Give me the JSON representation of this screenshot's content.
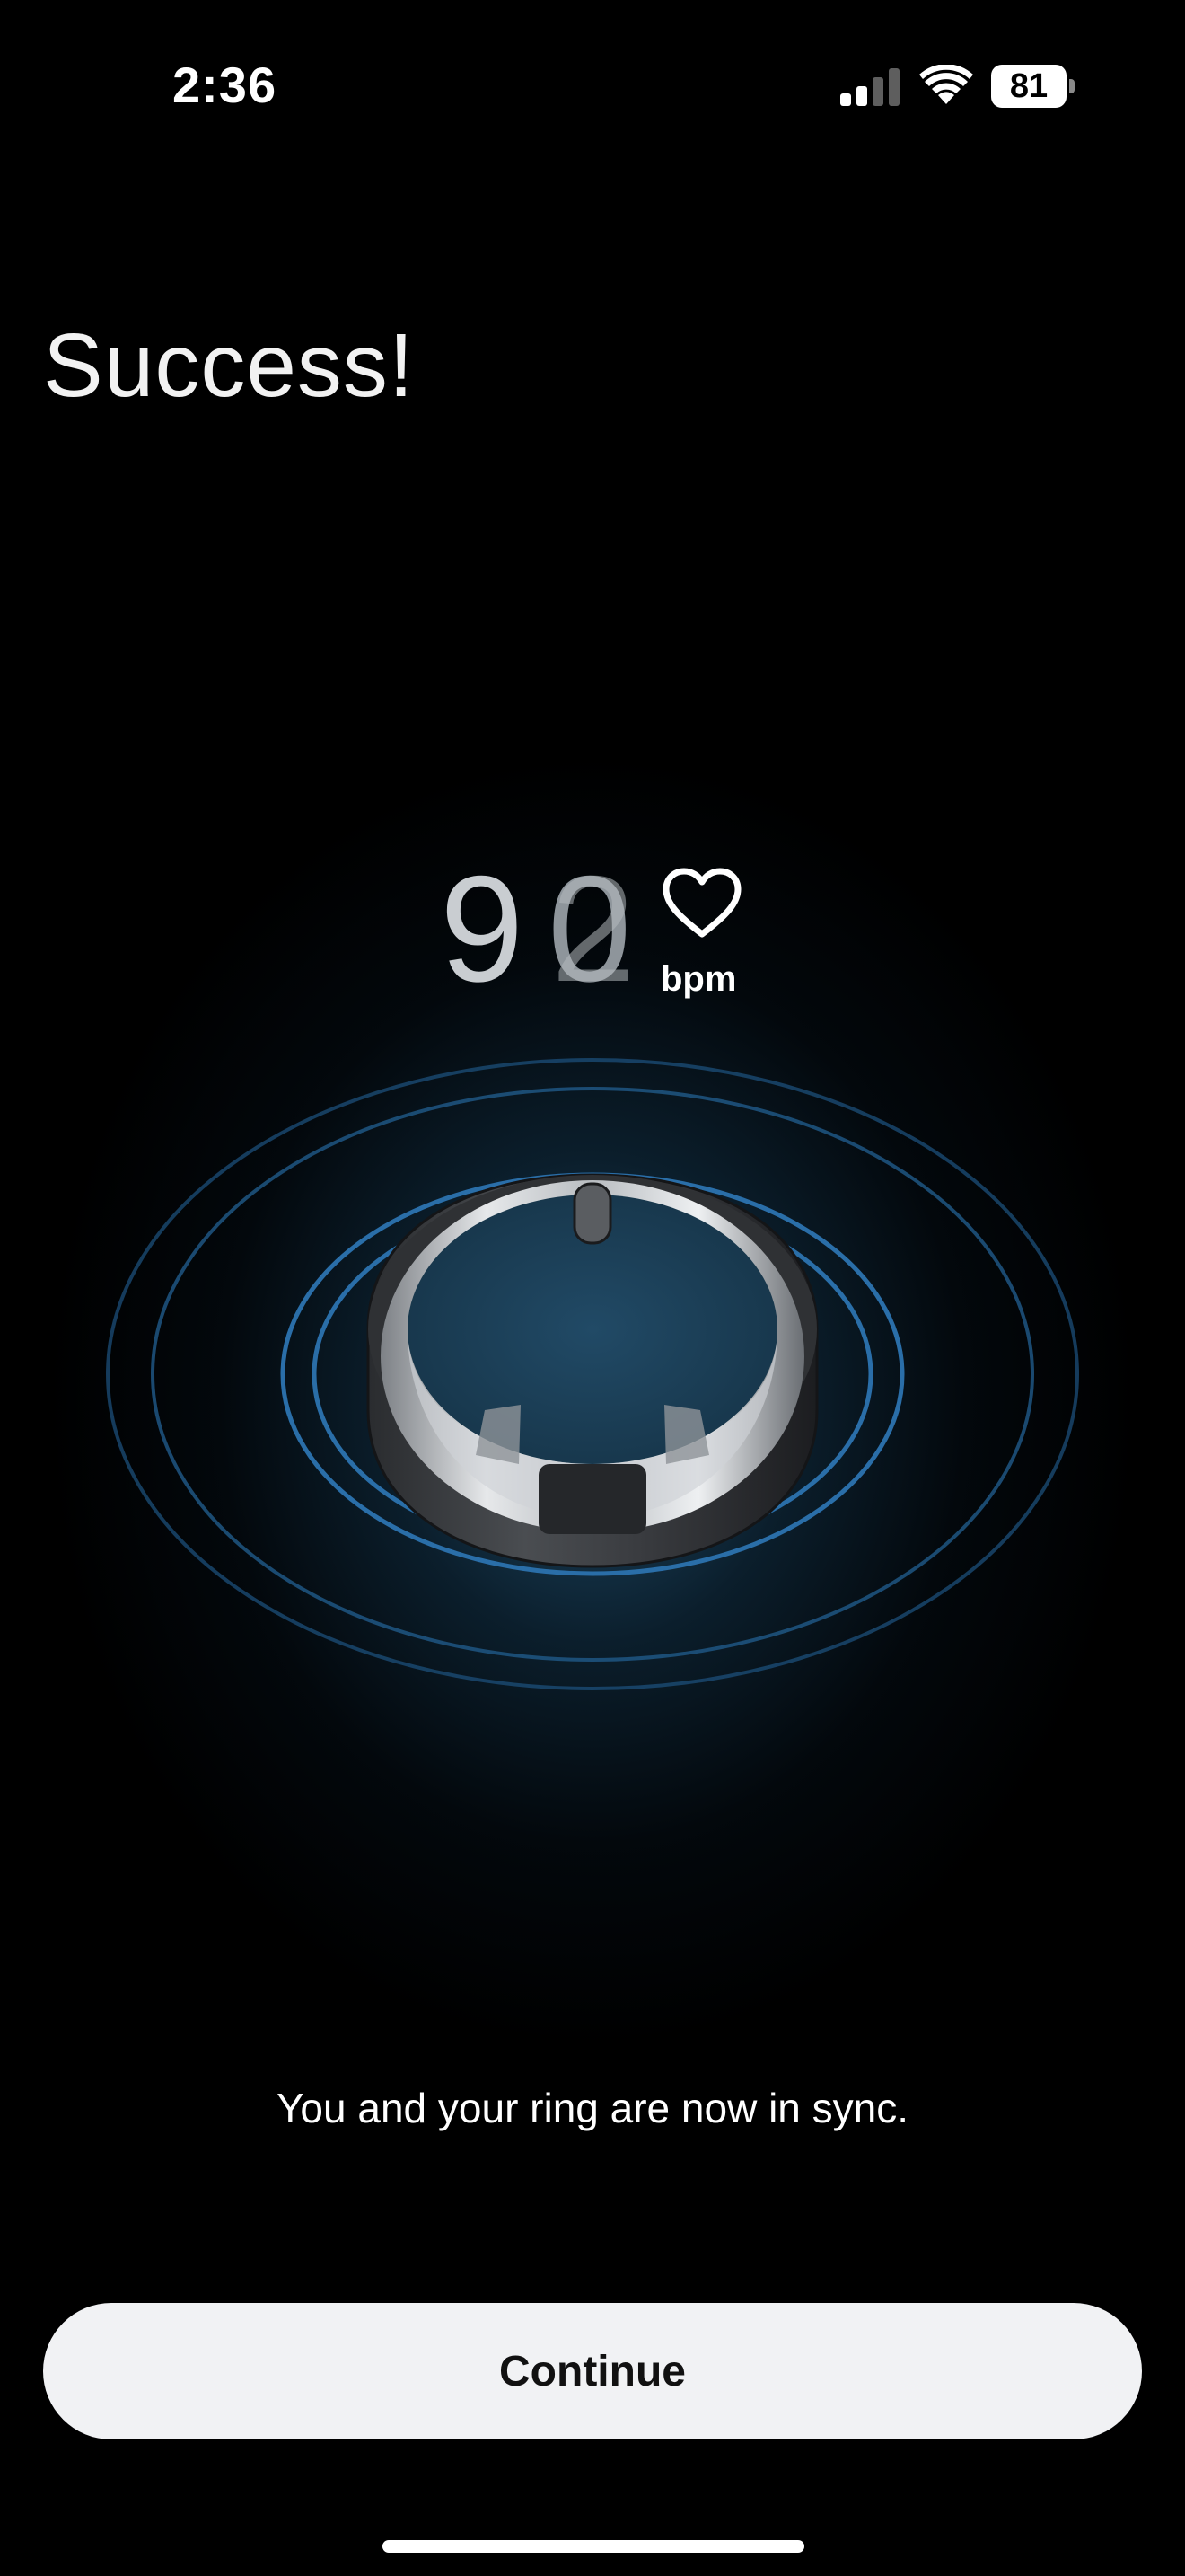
{
  "status_bar": {
    "time": "2:36",
    "battery_percent": "81",
    "signal_icon": "cellular-signal-icon",
    "wifi_icon": "wifi-icon"
  },
  "page": {
    "title": "Success!",
    "subtitle": "You and your ring are now in sync."
  },
  "heart_rate": {
    "digit_1": "9",
    "digit_2": "0",
    "digit_3": "2",
    "unit": "bpm",
    "icon": "heart-icon"
  },
  "illustration": {
    "icon": "smart-ring-icon"
  },
  "actions": {
    "continue_label": "Continue"
  },
  "colors": {
    "background": "#000000",
    "glow": "#265c80",
    "pulse_ring": "#2a6ea8",
    "button_bg": "#f1f2f4",
    "button_text": "#111111"
  }
}
